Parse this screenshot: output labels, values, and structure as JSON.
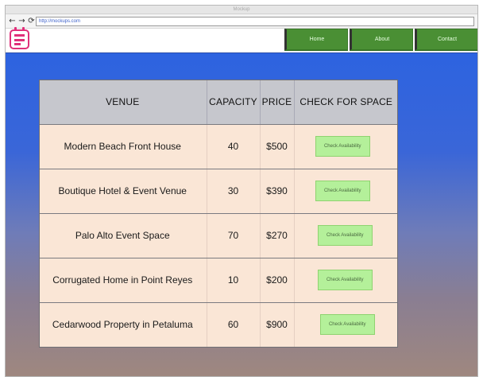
{
  "browser": {
    "title": "Mockup",
    "url": "http://mockups.com"
  },
  "header": {
    "nav": [
      {
        "label": "Home"
      },
      {
        "label": "About"
      },
      {
        "label": "Contact"
      }
    ]
  },
  "table": {
    "columns": [
      "VENUE",
      "CAPACITY",
      "PRICE",
      "CHECK FOR SPACE"
    ],
    "rows": [
      {
        "venue": "Modern Beach Front House",
        "capacity": "40",
        "price": "$500",
        "action": "Check Availability"
      },
      {
        "venue": "Boutique Hotel & Event Venue",
        "capacity": "30",
        "price": "$390",
        "action": "Check Availability"
      },
      {
        "venue": "Palo Alto Event Space",
        "capacity": "70",
        "price": "$270",
        "action": "Check Availability"
      },
      {
        "venue": "Corrugated Home in Point Reyes",
        "capacity": "10",
        "price": "$200",
        "action": "Check Availability"
      },
      {
        "venue": "Cedarwood Property in Petaluma",
        "capacity": "60",
        "price": "$900",
        "action": "Check Availability"
      }
    ]
  },
  "colors": {
    "logo": "#e0307a",
    "nav_button": "#4a8f34",
    "check_button": "#b4f09a",
    "table_body": "#fae6d6",
    "table_header": "#c6c7cd"
  },
  "icons": {
    "back": "arrow-left-icon",
    "forward": "arrow-right-icon",
    "reload": "reload-icon",
    "logo": "calendar-icon"
  }
}
